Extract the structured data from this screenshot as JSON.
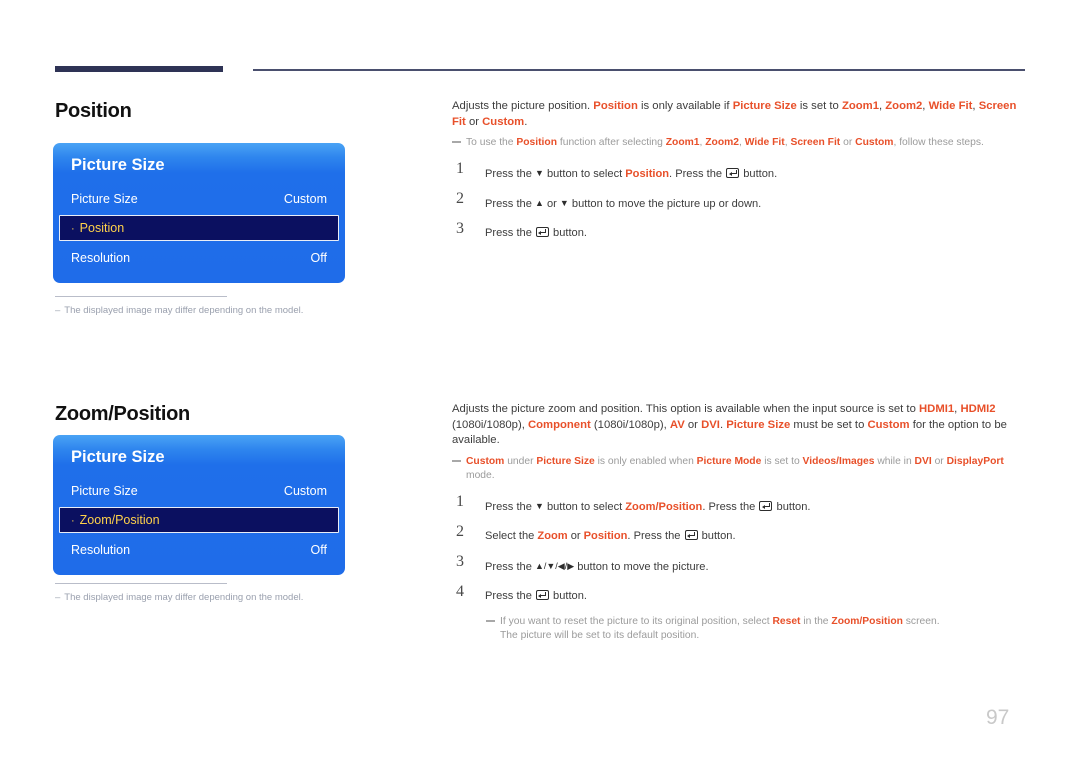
{
  "page": {
    "number": "97"
  },
  "sections": [
    {
      "heading": "Position",
      "osd": {
        "title": "Picture Size",
        "rows": [
          {
            "label": "Picture Size",
            "value": "Custom",
            "selected": false
          },
          {
            "label": "Position",
            "value": "",
            "selected": true,
            "bullet": "·"
          },
          {
            "label": "Resolution",
            "value": "Off",
            "selected": false
          }
        ]
      },
      "left_note": {
        "dash": "–",
        "text": "The displayed image may differ depending on the model."
      },
      "intro": {
        "t1": "Adjusts the picture position. ",
        "k1": "Position",
        "t2": " is only available if ",
        "k2": "Picture Size",
        "t3": " is set to ",
        "k3": "Zoom1",
        "t4": ", ",
        "k4": "Zoom2",
        "t5": ", ",
        "k5": "Wide Fit",
        "t6": ", ",
        "k6": "Screen Fit",
        "t7": " or ",
        "k7": "Custom",
        "t8": "."
      },
      "note": {
        "t1": "To use the ",
        "k1": "Position",
        "t2": " function after selecting ",
        "k2": "Zoom1",
        "t3": ", ",
        "k3": "Zoom2",
        "t4": ", ",
        "k4": "Wide Fit",
        "t5": ", ",
        "k5": "Screen Fit",
        "t6": " or ",
        "k6": "Custom",
        "t7": ", follow these steps."
      },
      "steps": [
        {
          "num": "1",
          "t1": "Press the ",
          "arrow": "▼",
          "t2": " button to select ",
          "k1": "Position",
          "t3": ". Press the ",
          "t4": " button."
        },
        {
          "num": "2",
          "t1": "Press the ",
          "arrow": "▲",
          "t2": " or ",
          "arrow2": "▼",
          "t3": " button to move the picture up or down."
        },
        {
          "num": "3",
          "t1": "Press the ",
          "t2": " button."
        }
      ]
    },
    {
      "heading": "Zoom/Position",
      "osd": {
        "title": "Picture Size",
        "rows": [
          {
            "label": "Picture Size",
            "value": "Custom",
            "selected": false
          },
          {
            "label": "Zoom/Position",
            "value": "",
            "selected": true,
            "bullet": "·"
          },
          {
            "label": "Resolution",
            "value": "Off",
            "selected": false
          }
        ]
      },
      "left_note": {
        "dash": "–",
        "text": "The displayed image may differ depending on the model."
      },
      "intro": {
        "t1": "Adjusts the picture zoom and position. This option is available when the input source is set to ",
        "k1": "HDMI1",
        "t2": ", ",
        "k2": "HDMI2",
        "t3": " (1080i/1080p), ",
        "k3": "Component",
        "t4": " (1080i/1080p), ",
        "k4": "AV",
        "t5": " or ",
        "k5": "DVI",
        "t6": ". ",
        "k6": "Picture Size",
        "t7": " must be set to ",
        "k7": "Custom",
        "t8": " for the option to be available."
      },
      "note": {
        "k1": "Custom",
        "t1": " under ",
        "k2": "Picture Size",
        "t2": " is only enabled when ",
        "k3": "Picture Mode",
        "t3": " is set to ",
        "k4": "Videos/Images",
        "t4": " while in ",
        "k5": "DVI",
        "t5": " or ",
        "k6": "DisplayPort",
        "t6": " mode."
      },
      "steps": [
        {
          "num": "1",
          "t1": "Press the ",
          "arrow": "▼",
          "t2": " button to select ",
          "k1": "Zoom/Position",
          "t3": ". Press the ",
          "t4": " button."
        },
        {
          "num": "2",
          "t1": "Select the ",
          "k1": "Zoom",
          "t2": " or ",
          "k2": "Position",
          "t3": ". Press the ",
          "t4": " button."
        },
        {
          "num": "3",
          "t1": "Press the ",
          "arrows": "▲/▼/◀/▶",
          "t2": " button to move the picture."
        },
        {
          "num": "4",
          "t1": "Press the ",
          "t2": " button."
        }
      ],
      "subnote": {
        "t1": "If you want to reset the picture to its original position, select ",
        "k1": "Reset",
        "t2": " in the ",
        "k2": "Zoom/Position",
        "t3": " screen.",
        "t4": "The picture will be set to its default position."
      }
    }
  ],
  "colors": {
    "accent_red": "#e8502a",
    "osd_blue": "#1f6ce9",
    "osd_selected_bg": "#0b1060",
    "osd_selected_text": "#ffd24a",
    "rule_navy": "#2e3355"
  }
}
